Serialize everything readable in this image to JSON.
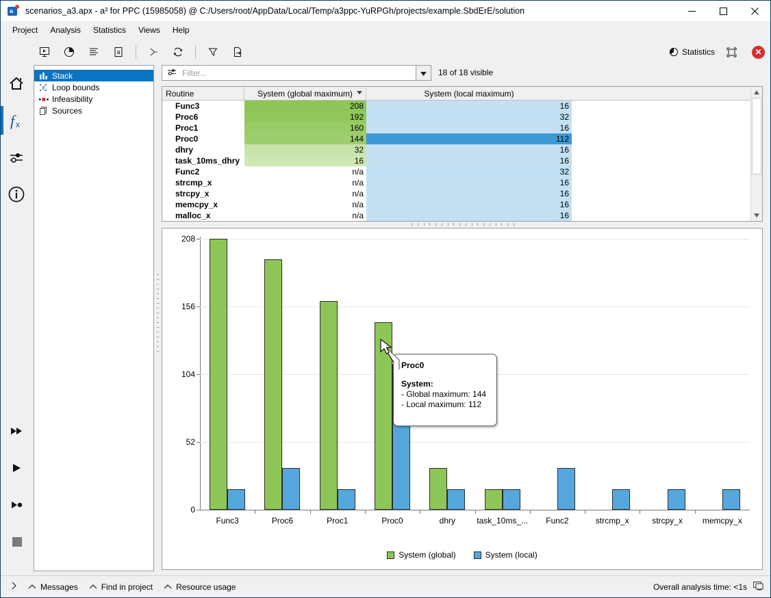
{
  "window": {
    "title": "scenarios_a3.apx - a³ for PPC (15985058) @ C:/Users/root/AppData/Local/Temp/a3ppc-YuRPGh/projects/example.SbdErE/solution",
    "minimize_label": "—",
    "maximize_label": "□",
    "close_label": "✕"
  },
  "menu": {
    "items": [
      {
        "label": "Project"
      },
      {
        "label": "Analysis"
      },
      {
        "label": "Statistics"
      },
      {
        "label": "Views"
      },
      {
        "label": "Help"
      }
    ]
  },
  "toolbar": {
    "buttons": [
      {
        "name": "report-icon",
        "title": "Report"
      },
      {
        "name": "pie-chart-icon",
        "title": "Pie chart"
      },
      {
        "name": "list-icon",
        "title": "List"
      },
      {
        "name": "annotation-icon",
        "title": "Annotation"
      },
      {
        "name": "run-icon",
        "title": "Run"
      },
      {
        "name": "refresh-icon",
        "title": "Refresh"
      },
      {
        "name": "filter-icon",
        "title": "Filter"
      },
      {
        "name": "export-icon",
        "title": "Export"
      }
    ],
    "statistics_label": "Statistics",
    "restore_label": "Restore",
    "close_label": "✕"
  },
  "rail": {
    "items": [
      {
        "name": "home-icon",
        "active": false
      },
      {
        "name": "function-icon",
        "active": true
      },
      {
        "name": "settings-sliders-icon",
        "active": false
      },
      {
        "name": "info-icon",
        "active": false
      }
    ],
    "bottom_items": [
      {
        "name": "fast-forward-icon"
      },
      {
        "name": "play-icon"
      },
      {
        "name": "step-icon"
      },
      {
        "name": "stop-icon"
      }
    ]
  },
  "tree": {
    "items": [
      {
        "label": "Stack",
        "icon": "bar-chart-icon",
        "selected": true
      },
      {
        "label": "Loop bounds",
        "icon": "loop-bounds-icon",
        "selected": false
      },
      {
        "label": "Infeasibility",
        "icon": "infeasibility-icon",
        "selected": false
      },
      {
        "label": "Sources",
        "icon": "sources-icon",
        "selected": false
      }
    ]
  },
  "filter": {
    "placeholder": "Filter...",
    "value": "",
    "visible_count_label": "18 of 18 visible"
  },
  "table": {
    "columns": [
      {
        "label": "Routine",
        "sorted": false
      },
      {
        "label": "System (global maximum)",
        "sorted": true
      },
      {
        "label": "System (local maximum)",
        "sorted": false
      }
    ],
    "rows": [
      {
        "routine": "Func3",
        "global": "208",
        "local": "16",
        "global_shade": 1.0,
        "local_shade": 0.35,
        "local_selected": false
      },
      {
        "routine": "Proc6",
        "global": "192",
        "local": "32",
        "global_shade": 0.95,
        "local_shade": 0.38,
        "local_selected": false
      },
      {
        "routine": "Proc1",
        "global": "160",
        "local": "16",
        "global_shade": 0.85,
        "local_shade": 0.35,
        "local_selected": false
      },
      {
        "routine": "Proc0",
        "global": "144",
        "local": "112",
        "global_shade": 0.8,
        "local_shade": 1.0,
        "local_selected": true
      },
      {
        "routine": "dhry",
        "global": "32",
        "local": "16",
        "global_shade": 0.25,
        "local_shade": 0.35,
        "local_selected": false
      },
      {
        "routine": "task_10ms_dhry",
        "global": "16",
        "local": "16",
        "global_shade": 0.18,
        "local_shade": 0.35,
        "local_selected": false
      },
      {
        "routine": "Func2",
        "global": "n/a",
        "local": "32",
        "global_shade": null,
        "local_shade": 0.38,
        "local_selected": false
      },
      {
        "routine": "strcmp_x",
        "global": "n/a",
        "local": "16",
        "global_shade": null,
        "local_shade": 0.35,
        "local_selected": false
      },
      {
        "routine": "strcpy_x",
        "global": "n/a",
        "local": "16",
        "global_shade": null,
        "local_shade": 0.35,
        "local_selected": false
      },
      {
        "routine": "memcpy_x",
        "global": "n/a",
        "local": "16",
        "global_shade": null,
        "local_shade": 0.35,
        "local_selected": false
      },
      {
        "routine": "malloc_x",
        "global": "n/a",
        "local": "16",
        "global_shade": null,
        "local_shade": 0.35,
        "local_selected": false
      }
    ]
  },
  "chart_data": {
    "type": "bar",
    "title": "",
    "xlabel": "",
    "ylabel": "",
    "ylim": [
      0,
      208
    ],
    "yticks": [
      0,
      52,
      104,
      156,
      208
    ],
    "grid": true,
    "legend_position": "bottom",
    "categories": [
      "Func3",
      "Proc6",
      "Proc1",
      "Proc0",
      "dhry",
      "task_10ms_...",
      "Func2",
      "strcmp_x",
      "strcpy_x",
      "memcpy_x"
    ],
    "series": [
      {
        "name": "System (global)",
        "color": "#8dc656",
        "values": [
          208,
          192,
          160,
          144,
          32,
          16,
          null,
          null,
          null,
          null
        ]
      },
      {
        "name": "System (local)",
        "color": "#55a8dd",
        "values": [
          16,
          32,
          16,
          112,
          16,
          16,
          32,
          16,
          16,
          16
        ]
      }
    ]
  },
  "tooltip": {
    "title": "Proc0",
    "section": "System:",
    "line1": "- Global maximum: 144",
    "line2": "- Local maximum: 112"
  },
  "statusbar": {
    "expand_label": "❯",
    "items": [
      {
        "label": "Messages"
      },
      {
        "label": "Find in project"
      },
      {
        "label": "Resource usage"
      }
    ],
    "analysis_time": "Overall analysis time: <1s"
  },
  "colors": {
    "accent": "#0a74c4",
    "green": "#8dc656",
    "blue": "#55a8dd",
    "selection_blue": "#3c9ad6",
    "close_red": "#d32f2f"
  }
}
